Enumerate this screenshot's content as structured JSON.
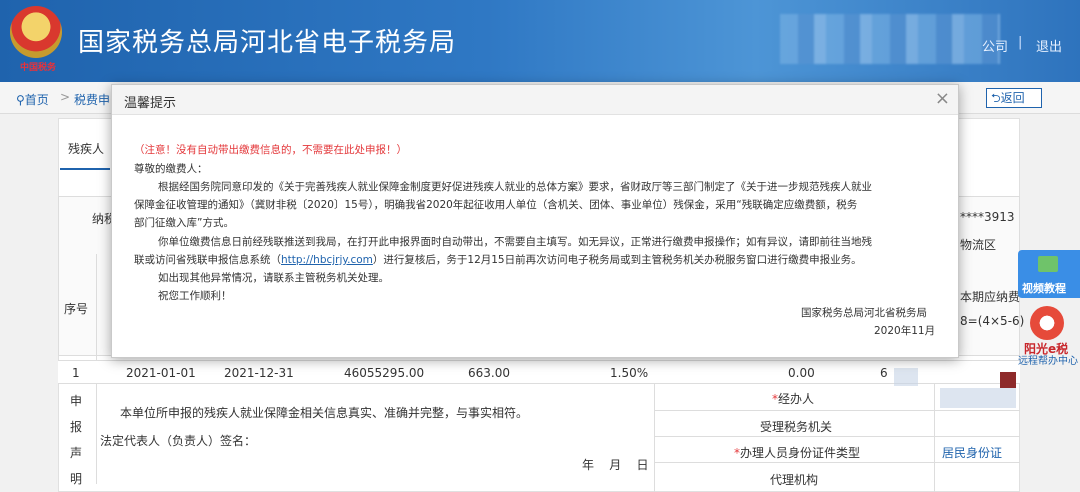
{
  "header": {
    "emblem_text": "中国税务",
    "title": "国家税务总局河北省电子税务局",
    "company_link": "公司",
    "separator": "|",
    "logout_link": "退出"
  },
  "breadcrumb": {
    "home": "首页",
    "separator": ">",
    "current": "税费申",
    "back_button": "返回"
  },
  "background_page": {
    "tab_label": "残疾人",
    "taxpayer_label": "纳税",
    "taxpayer_id_tail": "****3913",
    "region_tail": "物流区",
    "period_label": "本期应纳费",
    "formula": "8=(4×5-6)",
    "seq_header": "序号",
    "row": {
      "seq": "1",
      "start": "2021-01-01",
      "end": "2021-12-31",
      "amount": "46055295.00",
      "count": "663.00",
      "rate": "1.50%",
      "paid": "0.00",
      "tail": "6"
    },
    "declare_chars": [
      "申",
      "报",
      "声",
      "明"
    ],
    "declaration": "本单位所申报的残疾人就业保障金相关信息真实、准确并完整，与事实相符。",
    "legal_rep": "法定代表人（负责人）签名：",
    "date_placeholder": "年    月    日",
    "agent_label": "*经办人",
    "tax_office_label": "受理税务机关",
    "id_type_label": "*办理人员身份证件类型",
    "id_type_value": "居民身份证",
    "agency_label": "代理机构"
  },
  "float_panel": {
    "video_label": "视频教程",
    "sun_label": "阳光e税",
    "remote_label": "远程帮办中心"
  },
  "modal": {
    "title": "温馨提示",
    "close": "×",
    "warning": "（注意！没有自动带出缴费信息的，不需要在此处申报！）",
    "greeting": "尊敬的缴费人：",
    "para1_line1": "根据经国务院同意印发的《关于完善残疾人就业保障金制度更好促进残疾人就业的总体方案》要求，省财政厅等三部门制定了《关于进一步规范残疾人就业",
    "para1_line2": "保障金征收管理的通知》（冀财非税〔2020〕15号），明确我省2020年起征收用人单位（含机关、团体、事业单位）残保金，采用“残联确定应缴费额，税务",
    "para1_line3": "部门征缴入库”方式。",
    "para2_line1": "你单位缴费信息日前经残联推送到我局，在打开此申报界面时自动带出，不需要自主填写。如无异议，正常进行缴费申报操作；如有异议，请即前往当地残",
    "para2_line2_a": "联或访问省残联申报信息系统（",
    "para2_link": "http://hbcjrjy.com",
    "para2_line2_b": "）进行复核后，务于12月15日前再次访问电子税务局或到主管税务机关办税服务窗口进行缴费申报业务。",
    "para3": "如出现其他异常情况，请联系主管税务机关处理。",
    "para4": "祝您工作顺利！",
    "signature": "国家税务总局河北省税务局",
    "date": "2020年11月"
  }
}
